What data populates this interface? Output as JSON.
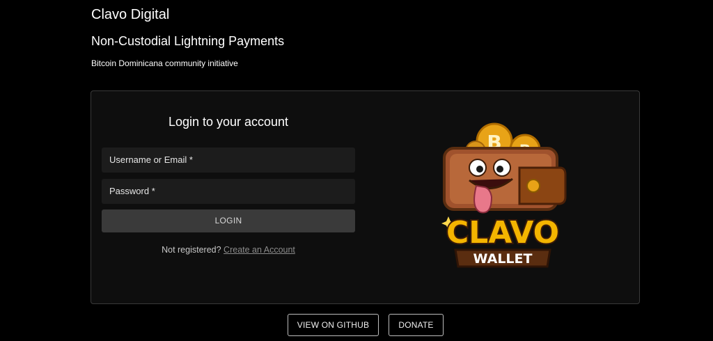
{
  "header": {
    "title": "Clavo Digital",
    "subtitle": "Non-Custodial Lightning Payments",
    "tagline": "Bitcoin Dominicana community initiative"
  },
  "login": {
    "heading": "Login to your account",
    "username_label": "Username or Email *",
    "password_label": "Password *",
    "login_button": "LOGIN",
    "not_registered": "Not registered?",
    "create_account": "Create an Account"
  },
  "logo": {
    "word1": "CLAVO",
    "word2": "WALLET"
  },
  "footer": {
    "github_button": "VIEW ON GITHUB",
    "donate_button": "DONATE"
  },
  "colors": {
    "background": "#000000",
    "card": "#0e0e0e",
    "input": "#1c1c1c",
    "button": "#3a3a3a",
    "logo_gold": "#f4b400",
    "wallet_brown": "#a0522d"
  }
}
